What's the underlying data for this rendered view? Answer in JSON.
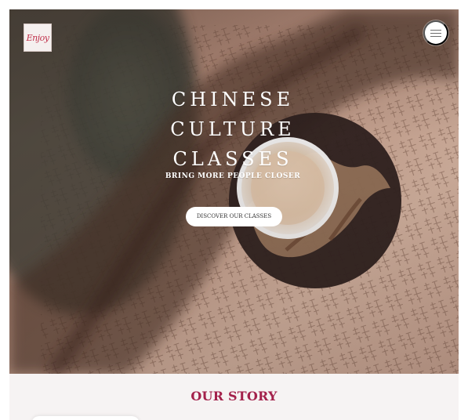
{
  "header": {
    "logo_text": "Enjoy"
  },
  "hero": {
    "title_lines": [
      "CHINESE",
      "CULTURE",
      "CLASSES"
    ],
    "subtitle": "BRING MORE PEOPLE CLOSER",
    "cta_label": "DISCOVER OUR CLASSES",
    "menu_icon": "hamburger-menu-icon"
  },
  "story": {
    "heading": "OUR STORY"
  },
  "colors": {
    "accent": "#a3214b",
    "button_bg": "#ffffff",
    "section_bg": "#f6f3f3"
  }
}
